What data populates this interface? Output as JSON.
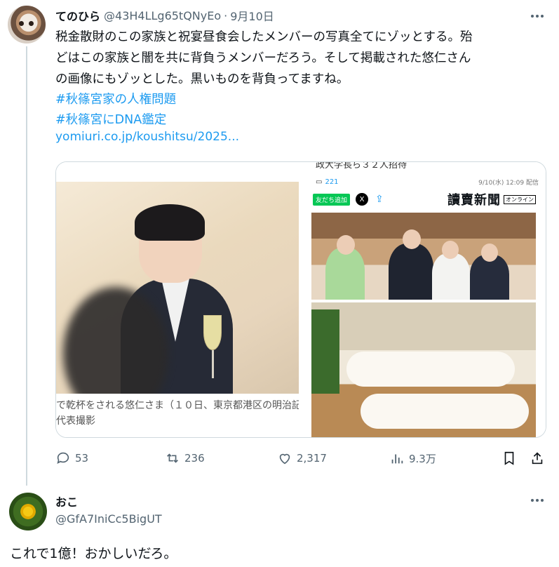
{
  "tweet": {
    "display_name": "てのひら",
    "handle": "@43H4LLg65tQNyEo",
    "separator": "·",
    "date": "9月10日",
    "body_lines": [
      "税金散財のこの家族と祝宴昼食会したメンバーの写真全てにゾッとする。殆",
      "どはこの家族と闇を共に背負うメンバーだろう。そして掲載された悠仁さん",
      "の画像にもゾッとした。黒いものを背負ってますね。"
    ],
    "hashtags": [
      "#秋篠宮家の人権問題",
      "#秋篠宮にDNA鑑定"
    ],
    "link": "yomiuri.co.jp/koushitsu/2025...",
    "media": {
      "left_caption_line1": "で乾杯をされる悠仁さま（１０日、東京都港区の明治記",
      "left_caption_line2": "代表撮影",
      "right_header": "政大学長ら３２人招待",
      "comment_count": "221",
      "article_time": "9/10(水) 12:09 配信",
      "line_button": "友だち追加",
      "x_button": "X",
      "newspaper_logo": "讀賣新聞",
      "online_badge": "オンライン"
    },
    "actions": {
      "replies": "53",
      "reposts": "236",
      "likes": "2,317",
      "views": "9.3万"
    }
  },
  "reply": {
    "display_name": "おこ",
    "handle": "@GfA7IniCc5BigUT",
    "text": "これで1億！おかしいだろ。"
  },
  "colors": {
    "link": "#1d9bf0",
    "text": "#0f1419",
    "muted": "#536471",
    "border": "#cfd9de"
  }
}
